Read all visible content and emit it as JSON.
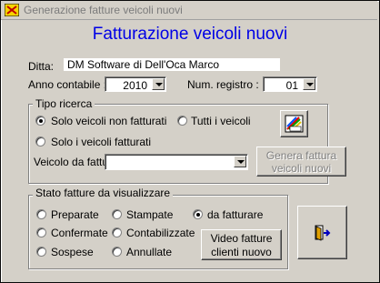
{
  "window": {
    "title": "Generazione fatture veicoli nuovi"
  },
  "header": {
    "title": "Fatturazione veicoli nuovi"
  },
  "form": {
    "ditta_label": "Ditta:",
    "ditta_value": "DM Software di Dell'Oca Marco",
    "anno_label": "Anno contabile :",
    "anno_value": "2010",
    "registro_label": "Num. registro :",
    "registro_value": "01"
  },
  "tipo_ricerca": {
    "legend": "Tipo ricerca",
    "options": [
      {
        "label": "Solo veicoli non fatturati",
        "selected": true
      },
      {
        "label": "Tutti i veicoli",
        "selected": false
      },
      {
        "label": "Solo i veicoli fatturati",
        "selected": false
      }
    ],
    "veicolo_label": "Veicolo da fatturare :",
    "veicolo_value": "",
    "report_icon": "chart-report-icon",
    "genera_button_line1": "Genera fattura",
    "genera_button_line2": "veicoli nuovi"
  },
  "stato": {
    "legend": "Stato  fatture da visualizzare",
    "options": [
      {
        "label": "Preparate",
        "selected": false
      },
      {
        "label": "Stampate",
        "selected": false
      },
      {
        "label": "da fatturare",
        "selected": true
      },
      {
        "label": "Confermate",
        "selected": false
      },
      {
        "label": "Contabilizzate",
        "selected": false
      },
      {
        "label": "Sospese",
        "selected": false
      },
      {
        "label": "Annullate",
        "selected": false
      }
    ],
    "video_button_line1": "Video fatture",
    "video_button_line2": "clienti nuovo"
  },
  "exit_button": {
    "icon": "exit-door-icon"
  },
  "colors": {
    "title": "#0000e6",
    "background": "#d4d0c8"
  }
}
